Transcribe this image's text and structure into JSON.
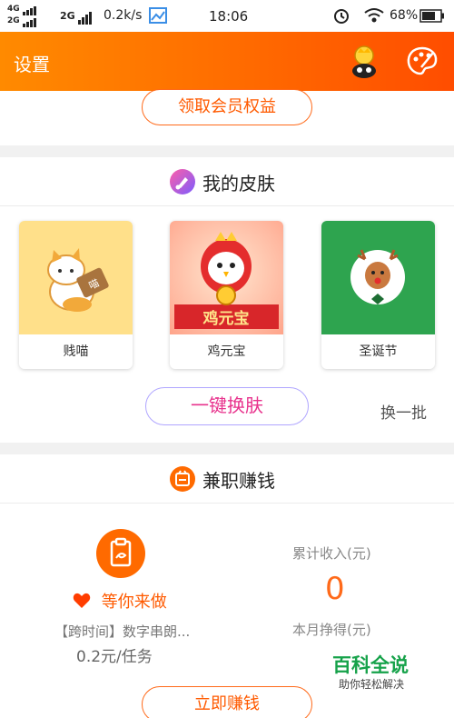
{
  "status_bar": {
    "net1": "4G",
    "net2": "2G",
    "net3": "2G",
    "speed": "0.2k/s",
    "time": "18:06",
    "battery": "68%",
    "icons": [
      "signal-icon",
      "image-icon",
      "alarm-icon",
      "wifi-icon",
      "battery-icon"
    ]
  },
  "header": {
    "title": "设置",
    "icons": [
      "crown-mascot-icon",
      "palette-icon"
    ],
    "accent": "#ff6a00"
  },
  "member": {
    "button_label": "领取会员权益"
  },
  "skins": {
    "section_title": "我的皮肤",
    "icon": "skin-brush-icon",
    "items": [
      {
        "name": "贱喵",
        "icon": "cat-icon"
      },
      {
        "name": "鸡元宝",
        "icon": "chicken-icon",
        "badge": "鸡元宝"
      },
      {
        "name": "圣诞节",
        "icon": "reindeer-icon"
      }
    ],
    "apply_button": "一键换肤",
    "refresh_label": "换一批"
  },
  "parttime": {
    "section_title": "兼职赚钱",
    "icon": "wallet-icon",
    "task_icon": "clipboard-icon",
    "wait_label": "等你来做",
    "task_name": "【跨时间】数字串朗...",
    "task_price": "0.2元/任务",
    "income_label": "累计收入(元)",
    "income_value": "0",
    "month_label": "本月挣得(元)",
    "earn_button": "立即赚钱"
  },
  "watermark": {
    "main": "百科全说",
    "sub": "助你轻松解决"
  }
}
